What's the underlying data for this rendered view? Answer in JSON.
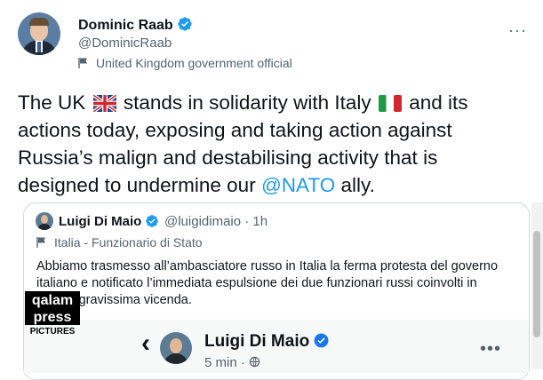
{
  "author": {
    "name": "Dominic Raab",
    "handle": "@DominicRaab",
    "label": "United Kingdom government official"
  },
  "tweet": {
    "text_part1": "The UK",
    "text_part2": "stands in solidarity with Italy",
    "text_part3": "and its actions today, exposing and taking action against Russia’s malign and destabilising activity that is designed to undermine our",
    "mention": "@NATO",
    "text_part4": "ally."
  },
  "quoted": {
    "name": "Luigi Di Maio",
    "handle": "@luigidimaio · 1h",
    "label": "Italia - Funzionario di Stato",
    "text": "Abbiamo trasmesso all’ambasciatore russo in Italia la ferma protesta del governo italiano e notificato l’immediata espulsione dei due funzionari russi coinvolti in questa gravissima vicenda."
  },
  "embedded_post": {
    "name": "Luigi Di Maio",
    "time": "5 min ·"
  },
  "watermark": {
    "line1": "qalam",
    "line2": "press",
    "line3": "PICTURES"
  },
  "colors": {
    "accent": "#1d9bf0",
    "secondary_text": "#536471",
    "border": "#cfd9de"
  },
  "icons": {
    "verified": "verified-badge-icon",
    "flag_label": "government-flag-icon",
    "more": "more-options-icon",
    "back": "back-arrow-icon",
    "uk_flag": "uk-flag-emoji",
    "italy_flag": "italy-flag-emoji"
  }
}
